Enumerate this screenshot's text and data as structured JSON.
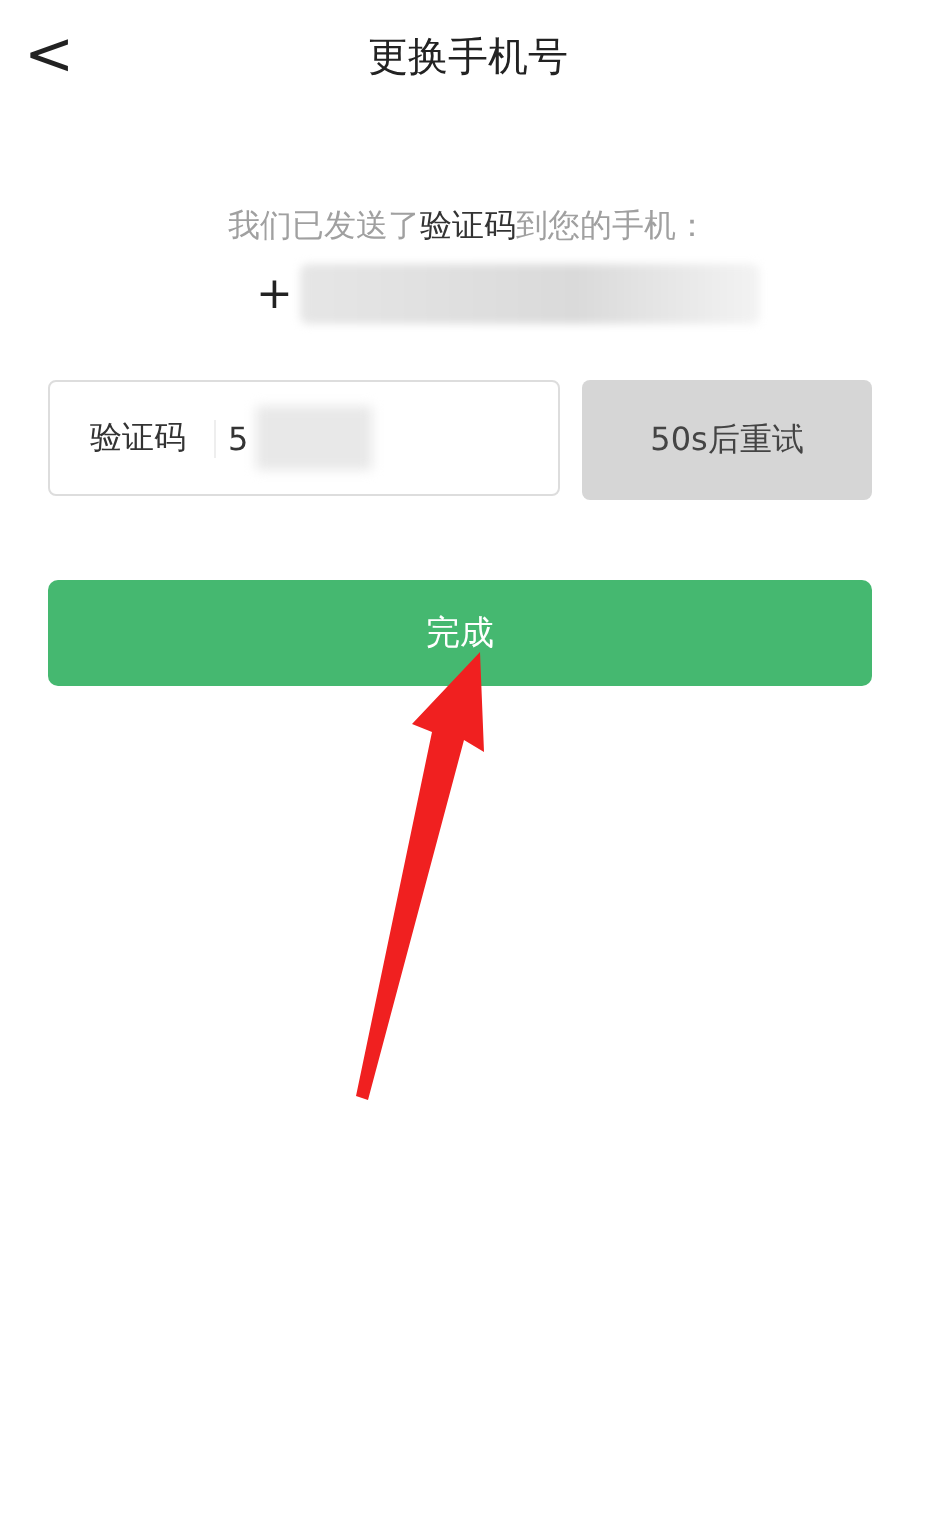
{
  "header": {
    "back": "<",
    "title": "更换手机号"
  },
  "message": "我们已发送了**验证码**到您的手机：",
  "phone": {
    "prefix": "+"
  },
  "code_field": {
    "label": "验证码",
    "value": "5"
  },
  "retry_button": {
    "label": "50s后重试",
    "disabled": true
  },
  "done_button": {
    "label": "完成"
  }
}
